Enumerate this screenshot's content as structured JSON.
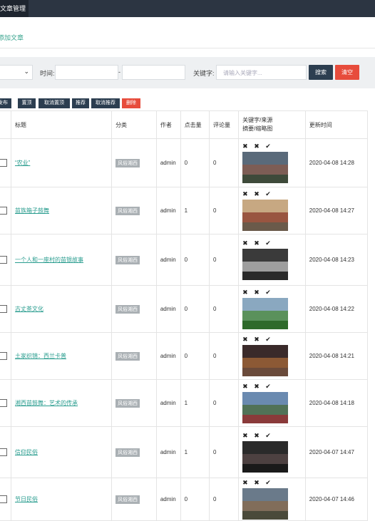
{
  "nav": {
    "active_tab": "文章管理"
  },
  "add_link": "添加文章",
  "filters": {
    "time_label": "时间:",
    "date_separator": "-",
    "keyword_label": "关键字:",
    "keyword_placeholder": "请输入关键字...",
    "search_label": "搜索",
    "clear_label": "清空"
  },
  "actions": [
    "发布",
    "置顶",
    "取消置顶",
    "推荐",
    "取消推荐",
    "删除"
  ],
  "table": {
    "headers": {
      "title": "标题",
      "category": "分类",
      "author": "作者",
      "clicks": "点击量",
      "comments": "评论量",
      "keywords_line1": "关键字/来源",
      "keywords_line2": "摘要/缩略图",
      "updated": "更新时间"
    },
    "rows": [
      {
        "title": "“农业”",
        "category": "风俗湘西",
        "author": "admin",
        "clicks": "0",
        "comments": "0",
        "ops": "✖ ✖ ✔",
        "updated": "2020-04-08 14:28",
        "thumb_colors": [
          "#5a6a7a",
          "#8a5a4a",
          "#3e4a3a"
        ]
      },
      {
        "title": "苗族箱子鼓舞",
        "category": "风俗湘西",
        "author": "admin",
        "clicks": "1",
        "comments": "0",
        "ops": "✖ ✖ ✔",
        "updated": "2020-04-08 14:27",
        "thumb_colors": [
          "#c7a882",
          "#8a3a2a",
          "#6a5a4a"
        ]
      },
      {
        "title": "一个人和一座村的苗银故事",
        "category": "风俗湘西",
        "author": "admin",
        "clicks": "0",
        "comments": "0",
        "ops": "✖ ✖ ✔",
        "updated": "2020-04-08 14:23",
        "thumb_colors": [
          "#3a3a3a",
          "#c0c0c0",
          "#2a2a2a"
        ]
      },
      {
        "title": "古丈茶文化",
        "category": "风俗湘西",
        "author": "admin",
        "clicks": "0",
        "comments": "0",
        "ops": "✖ ✖ ✔",
        "updated": "2020-04-08 14:22",
        "thumb_colors": [
          "#8aa8c0",
          "#4a8a3a",
          "#2e6a2a"
        ]
      },
      {
        "title": "土家织锦：西兰卡普",
        "category": "风俗湘西",
        "author": "admin",
        "clicks": "0",
        "comments": "0",
        "ops": "✖ ✖ ✔",
        "updated": "2020-04-08 14:21",
        "thumb_colors": [
          "#3a2a2a",
          "#a86a3a",
          "#6a4a3a"
        ]
      },
      {
        "title": "湘西苗鼓舞：艺术的传承",
        "category": "风俗湘西",
        "author": "admin",
        "clicks": "1",
        "comments": "0",
        "ops": "✖ ✖ ✔",
        "updated": "2020-04-08 14:18",
        "thumb_colors": [
          "#6a8ab0",
          "#4a6a3a",
          "#8a3a3a"
        ]
      },
      {
        "title": "信仰民俗",
        "category": "风俗湘西",
        "author": "admin",
        "clicks": "1",
        "comments": "0",
        "ops": "✖ ✖ ✔",
        "updated": "2020-04-07 14:47",
        "thumb_colors": [
          "#2a2a2a",
          "#5a4a4a",
          "#1a1a1a"
        ]
      },
      {
        "title": "节日民俗",
        "category": "风俗湘西",
        "author": "admin",
        "clicks": "0",
        "comments": "0",
        "ops": "✖ ✖ ✔",
        "updated": "2020-04-07 14:46",
        "thumb_colors": [
          "#6a7a8a",
          "#8a6a4a",
          "#4a4a3a"
        ]
      }
    ]
  }
}
